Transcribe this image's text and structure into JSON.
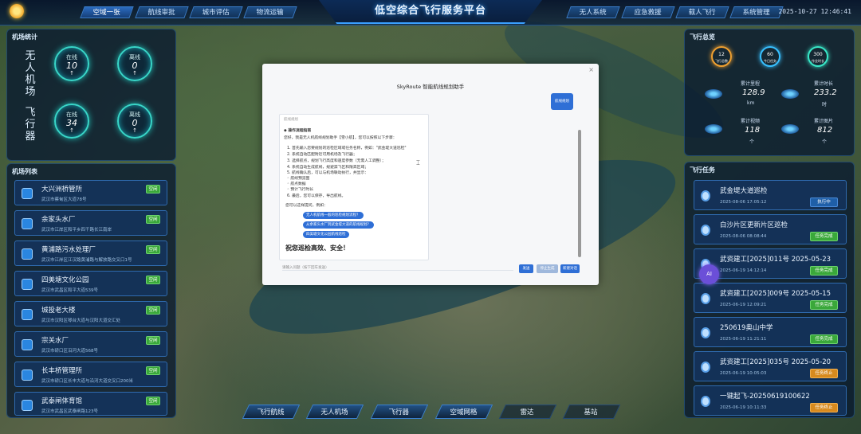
{
  "header": {
    "title": "低空综合飞行服务平台",
    "datetime": "2025-10-27 12:46:41",
    "nav_left": [
      "空域一张",
      "航线审批",
      "城市评估",
      "物流运输"
    ],
    "nav_right": [
      "无人系统",
      "应急救援",
      "载人飞行",
      "系统管理"
    ]
  },
  "left_panel": {
    "title": "机场统计",
    "dock_label": "无人机场",
    "craft_label": "飞行器",
    "dock_stats": [
      {
        "label": "在线",
        "value": "10"
      },
      {
        "label": "离线",
        "value": "0"
      }
    ],
    "craft_stats": [
      {
        "label": "在线",
        "value": "34"
      },
      {
        "label": "离线",
        "value": "0"
      }
    ],
    "arrow": "↑"
  },
  "site_list": {
    "title": "机场列表",
    "items": [
      {
        "name": "大兴洲桥管所",
        "address": "武汉市蔡甸区大道78号",
        "status": "空闲"
      },
      {
        "name": "余家头水厂",
        "address": "武汉市江岸区和平乡四干路长江南岸",
        "status": "空闲"
      },
      {
        "name": "黄浦路污水处理厂",
        "address": "武汉市江岸区江汉路黄浦路与解放路交叉口1号",
        "status": "空闲"
      },
      {
        "name": "四美塘文化公园",
        "address": "武汉市武昌区和平大道539号",
        "status": "空闲"
      },
      {
        "name": "城投老大楼",
        "address": "武汉市汉阳区琴台大道与汉阳大道交汇处",
        "status": "空闲"
      },
      {
        "name": "宗关水厂",
        "address": "武汉市硚口区沿河大道568号",
        "status": "空闲"
      },
      {
        "name": "长丰桥管理所",
        "address": "武汉市硚口区长丰大道与沿河大道交叉口200米",
        "status": "空闲"
      },
      {
        "name": "武泰闸体育馆",
        "address": "武汉市武昌区武泰闸路123号",
        "status": "空闲"
      }
    ]
  },
  "right_panel": {
    "title": "飞行总览",
    "rings": [
      {
        "label": "12",
        "sub": "飞行总数",
        "color": "#f0a030"
      },
      {
        "label": "60",
        "sub": "今日任务",
        "color": "#38c0ff"
      },
      {
        "label": "300",
        "sub": "作业时长",
        "color": "#38e8c8"
      }
    ],
    "stats": [
      {
        "label": "累计里程",
        "value": "128.9",
        "unit": "km"
      },
      {
        "label": "累计时长",
        "value": "233.2",
        "unit": "时"
      },
      {
        "label": "累计视频",
        "value": "118",
        "unit": "个"
      },
      {
        "label": "累计图片",
        "value": "812",
        "unit": "个"
      }
    ]
  },
  "tasks": {
    "title": "飞行任务",
    "items": [
      {
        "name": "武金堤大道巡检",
        "date": "2025-08-06 17:05:12",
        "status": "执行中",
        "kind": "blue"
      },
      {
        "name": "白沙片区更新片区巡检",
        "date": "2025-08-06 08:08:44",
        "status": "任务完成",
        "kind": "green"
      },
      {
        "name": "武资建工[2025]011号 2025-05-23",
        "date": "2025-06-19 14:12:14",
        "status": "任务完成",
        "kind": "green"
      },
      {
        "name": "武资建工[2025]009号 2025-05-15",
        "date": "2025-06-19 12:09:21",
        "status": "任务完成",
        "kind": "green"
      },
      {
        "name": "250619奥山中学",
        "date": "2025-06-19 11:21:11",
        "status": "任务完成",
        "kind": "green"
      },
      {
        "name": "武资建工[2025]035号 2025-05-20",
        "date": "2025-06-19 10:05:03",
        "status": "任务终止",
        "kind": "orange"
      },
      {
        "name": "一键起飞-20250619100622",
        "date": "2025-06-19 10:11:33",
        "status": "任务终止",
        "kind": "orange"
      }
    ]
  },
  "ai_badge": "AI",
  "bottom_nav": [
    "飞行航线",
    "无人机场",
    "飞行器",
    "空域网格",
    "雷达",
    "基站"
  ],
  "modal": {
    "close": "×",
    "title": "SkyRoute 智能航线规划助手",
    "user_message": "航线规划",
    "card_header": "航线规划",
    "intro_title": "◆ 操作流程指南",
    "lines": [
      "您好，我是无人机航线规划助手【雪小航】，您可以按照以下步骤：",
      "1. 首先输入您要规划的巡检区域或任务名称，例如：\"武金堤大道巡检\"",
      "2. 系统自动匹配附近可用机场及飞行器；",
      "3. 选择航点，规划飞行高度和速度参数（无需人工调整）；",
      "4. 系统自动生成航线，规避禁飞区和限高区域；",
      "5. 航线确认后，可以与机场联动执行，并显示：",
      "    ◦ 航线预览图",
      "    ◦ 航点数据",
      "    ◦ 预计飞行时长",
      "6. 最后，您可以保存，导出航线。"
    ],
    "example_label": "您可以这样提问，例如：",
    "pills": [
      "无人机航线一般的巡检规划流程？",
      "从余家头水厂到武金堤大道的航线规划？",
      "四美塘文化公园航线巡检"
    ],
    "slogan": "祝您巡检高效、安全！",
    "input_placeholder": "请输入问题（按下回车发送）",
    "btn_send": "发送",
    "btn_stop": "停止生成",
    "btn_new": "新建对话"
  }
}
